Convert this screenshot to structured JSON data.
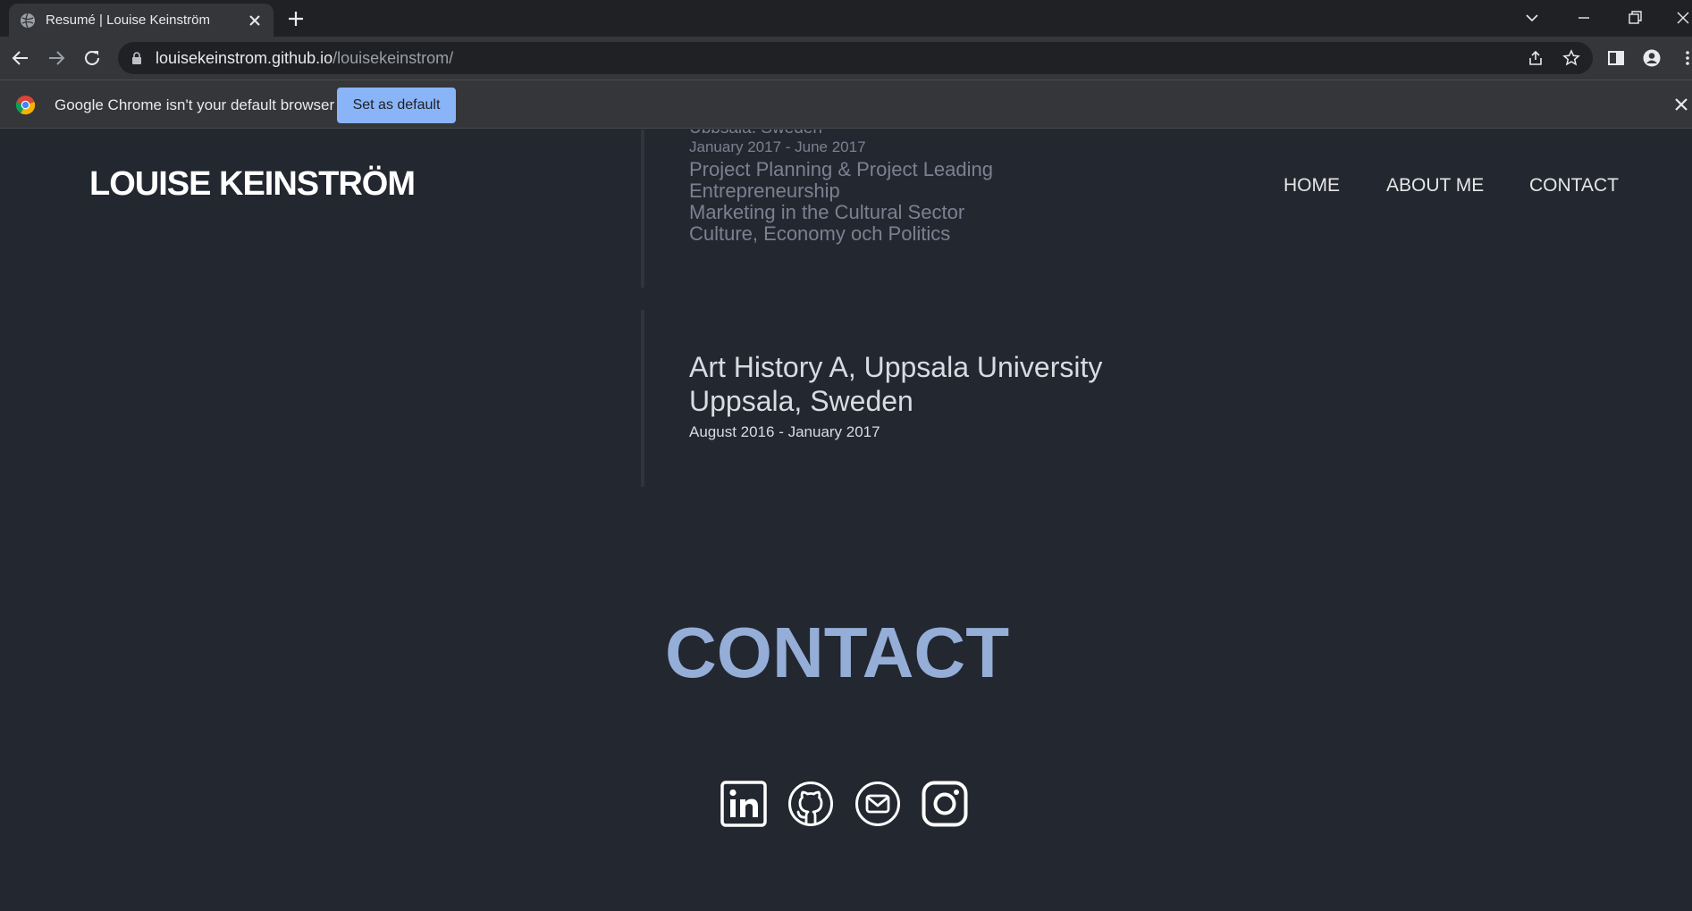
{
  "browser": {
    "tab_title": "Resumé | Louise Keinström",
    "url_host": "louisekeinstrom.github.io",
    "url_path": "/louisekeinstrom/",
    "infobar_message": "Google Chrome isn't your default browser",
    "infobar_button": "Set as default"
  },
  "site": {
    "brand": "LOUISE KEINSTRÖM",
    "nav": [
      "HOME",
      "ABOUT ME",
      "CONTACT"
    ]
  },
  "education": [
    {
      "date": "January 2017 - June 2017",
      "courses": [
        "Project Planning & Project Leading",
        "Entrepreneurship",
        "Marketing in the Cultural Sector",
        "Culture, Economy och Politics"
      ]
    },
    {
      "title": "Art History A, Uppsala University",
      "location": "Uppsala, Sweden",
      "date": "August 2016 - January 2017"
    }
  ],
  "contact": {
    "heading": "CONTACT",
    "icons": [
      "linkedin-icon",
      "github-icon",
      "email-icon",
      "instagram-icon"
    ]
  },
  "colors": {
    "page_background": "#232730",
    "contact_heading": "#94aed8",
    "infobar_button": "#8ab4f8"
  }
}
